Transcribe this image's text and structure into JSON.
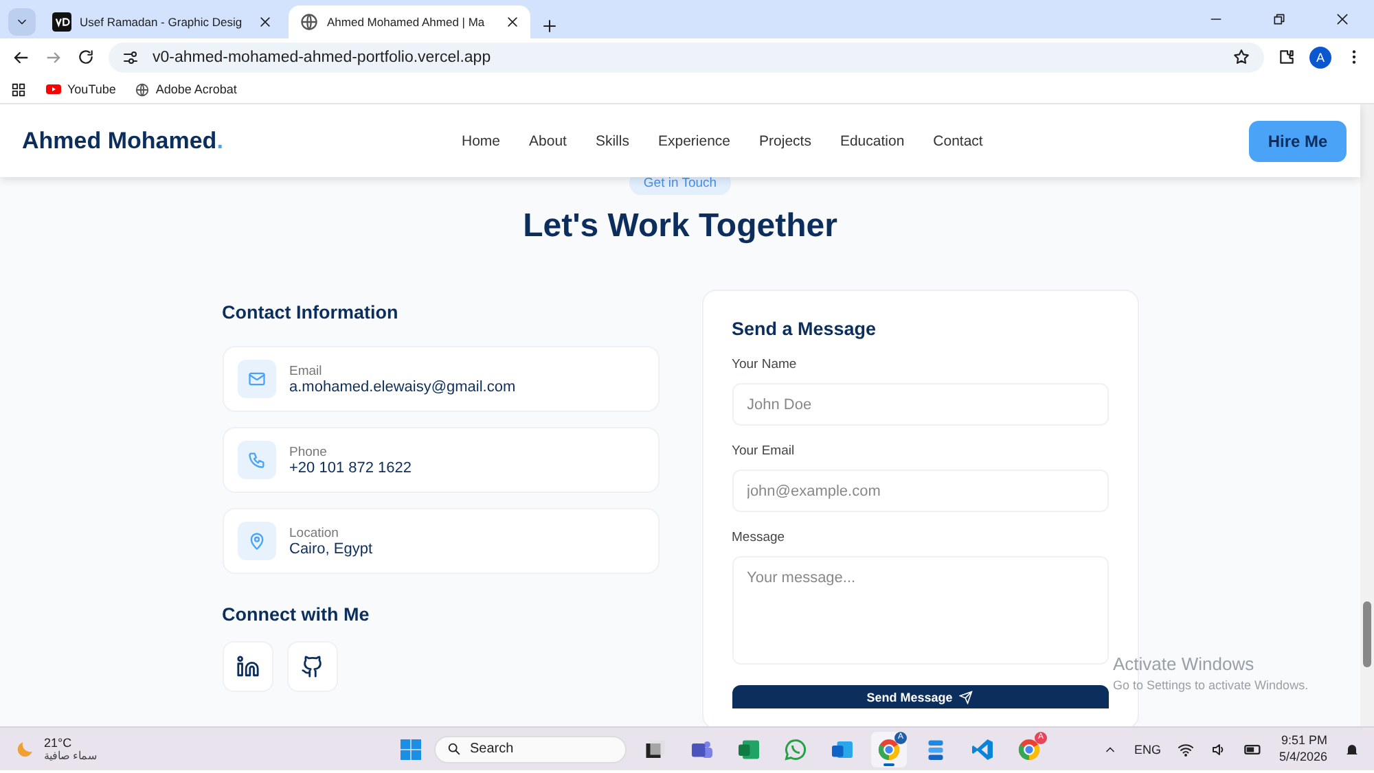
{
  "browser": {
    "tabs": [
      {
        "title": "Usef Ramadan - Graphic Desig",
        "selected": false
      },
      {
        "title": "Ahmed Mohamed Ahmed | Ma",
        "selected": true
      }
    ],
    "url": "v0-ahmed-mohamed-ahmed-portfolio.vercel.app",
    "profile_initial": "A",
    "bookmarks": [
      {
        "kind": "youtube",
        "label": "YouTube"
      },
      {
        "kind": "globe",
        "label": "Adobe Acrobat"
      }
    ]
  },
  "site": {
    "logo": "Ahmed Mohamed",
    "logo_dot": ".",
    "nav": [
      "Home",
      "About",
      "Skills",
      "Experience",
      "Projects",
      "Education",
      "Contact"
    ],
    "cta": "Hire Me"
  },
  "section": {
    "badge": "Get in Touch",
    "title": "Let's Work Together"
  },
  "contact_info": {
    "heading": "Contact Information",
    "items": [
      {
        "kind": "email",
        "label": "Email",
        "value": "a.mohamed.elewaisy@gmail.com"
      },
      {
        "kind": "phone",
        "label": "Phone",
        "value": "+20 101 872 1622"
      },
      {
        "kind": "location",
        "label": "Location",
        "value": "Cairo, Egypt"
      }
    ]
  },
  "connect": {
    "heading": "Connect with Me",
    "links": [
      {
        "kind": "linkedin"
      },
      {
        "kind": "github"
      }
    ]
  },
  "form": {
    "heading": "Send a Message",
    "fields": [
      {
        "kind": "input",
        "label": "Your Name",
        "placeholder": "John Doe"
      },
      {
        "kind": "input",
        "label": "Your Email",
        "placeholder": "john@example.com"
      },
      {
        "kind": "textarea",
        "label": "Message",
        "placeholder": "Your message..."
      }
    ],
    "submit": "Send Message"
  },
  "activation": {
    "title": "Activate Windows",
    "subtitle": "Go to Settings to activate Windows."
  },
  "taskbar": {
    "weather": {
      "temperature": "21°C",
      "condition": "سماء صافية"
    },
    "search_placeholder": "Search",
    "apps": [
      {
        "kind": "taskview",
        "selected": false
      },
      {
        "kind": "teams",
        "selected": false
      },
      {
        "kind": "excel",
        "selected": false
      },
      {
        "kind": "whatsapp",
        "selected": false
      },
      {
        "kind": "outlook",
        "selected": false
      },
      {
        "kind": "chrome",
        "selected": true,
        "badge": "A",
        "color": "#1f5fa8"
      },
      {
        "kind": "stack",
        "selected": false
      },
      {
        "kind": "vscode",
        "selected": false
      },
      {
        "kind": "chrome",
        "selected": false,
        "badge": "A",
        "color": "#e8455a"
      }
    ],
    "language": "ENG",
    "time": "9:51 PM",
    "date": "5/4/2026"
  }
}
